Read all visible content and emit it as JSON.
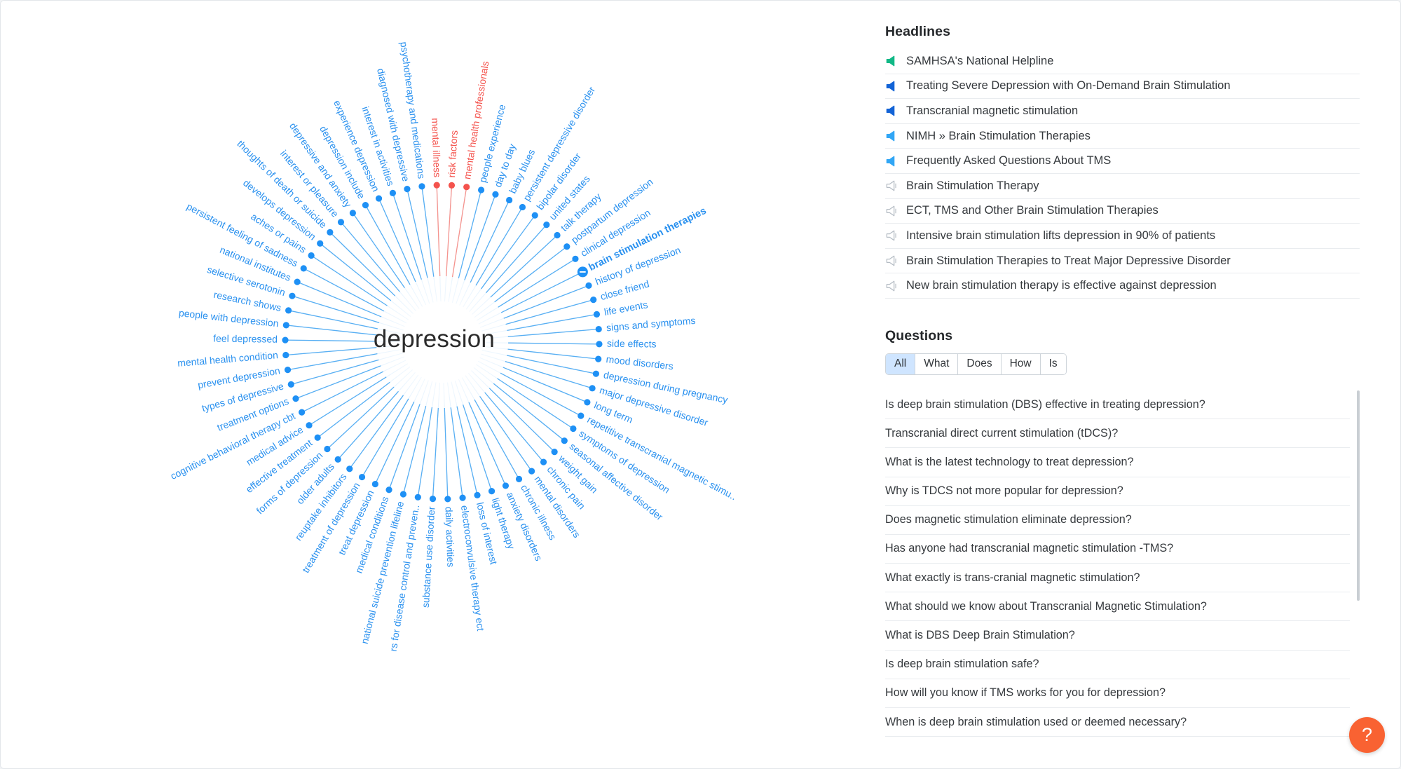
{
  "center_term": "depression",
  "graph": {
    "selected_node": "brain stimulation therapies",
    "node_colors": {
      "blue": "#1e90f5",
      "red": "#f4534d",
      "light_blue": "#6cb8f7"
    },
    "nodes": [
      {
        "label": "mental illness",
        "color": "red"
      },
      {
        "label": "risk factors",
        "color": "red"
      },
      {
        "label": "mental health professionals",
        "color": "red"
      },
      {
        "label": "people experience",
        "color": "blue"
      },
      {
        "label": "day to day",
        "color": "blue"
      },
      {
        "label": "baby blues",
        "color": "blue"
      },
      {
        "label": "persistent depressive disorder",
        "color": "blue"
      },
      {
        "label": "bipolar disorder",
        "color": "blue"
      },
      {
        "label": "united states",
        "color": "blue"
      },
      {
        "label": "talk therapy",
        "color": "blue"
      },
      {
        "label": "postpartum depression",
        "color": "blue"
      },
      {
        "label": "clinical depression",
        "color": "blue"
      },
      {
        "label": "brain stimulation therapies",
        "color": "blue",
        "selected": true
      },
      {
        "label": "history of depression",
        "color": "blue"
      },
      {
        "label": "close friend",
        "color": "blue"
      },
      {
        "label": "life events",
        "color": "blue"
      },
      {
        "label": "signs and symptoms",
        "color": "blue"
      },
      {
        "label": "side effects",
        "color": "blue"
      },
      {
        "label": "mood disorders",
        "color": "blue"
      },
      {
        "label": "depression during pregnancy",
        "color": "blue"
      },
      {
        "label": "major depressive disorder",
        "color": "blue"
      },
      {
        "label": "long term",
        "color": "blue"
      },
      {
        "label": "repetitive transcranial magnetic stimu..",
        "color": "blue"
      },
      {
        "label": "symptoms of depression",
        "color": "blue"
      },
      {
        "label": "seasonal affective disorder",
        "color": "blue"
      },
      {
        "label": "weight gain",
        "color": "blue"
      },
      {
        "label": "chronic pain",
        "color": "blue"
      },
      {
        "label": "mental disorders",
        "color": "blue"
      },
      {
        "label": "chronic illness",
        "color": "blue"
      },
      {
        "label": "anxiety disorders",
        "color": "blue"
      },
      {
        "label": "light therapy",
        "color": "blue"
      },
      {
        "label": "loss of interest",
        "color": "blue"
      },
      {
        "label": "electroconvulsive therapy ect",
        "color": "blue"
      },
      {
        "label": "daily activities",
        "color": "blue"
      },
      {
        "label": "substance use disorder",
        "color": "blue"
      },
      {
        "label": "rs for disease control and preven..",
        "color": "blue"
      },
      {
        "label": "national suicide prevention lifeline",
        "color": "blue"
      },
      {
        "label": "medical conditions",
        "color": "blue"
      },
      {
        "label": "treat depression",
        "color": "blue"
      },
      {
        "label": "treatment of depression",
        "color": "blue"
      },
      {
        "label": "reuptake inhibitors",
        "color": "blue"
      },
      {
        "label": "older adults",
        "color": "blue"
      },
      {
        "label": "forms of depression",
        "color": "blue"
      },
      {
        "label": "effective treatment",
        "color": "blue"
      },
      {
        "label": "medical advice",
        "color": "blue"
      },
      {
        "label": "cognitive behavioral therapy cbt",
        "color": "blue"
      },
      {
        "label": "treatment options",
        "color": "blue"
      },
      {
        "label": "types of depressive",
        "color": "blue"
      },
      {
        "label": "prevent depression",
        "color": "blue"
      },
      {
        "label": "mental health condition",
        "color": "blue"
      },
      {
        "label": "feel depressed",
        "color": "blue"
      },
      {
        "label": "people with depression",
        "color": "blue"
      },
      {
        "label": "research shows",
        "color": "blue"
      },
      {
        "label": "selective serotonin",
        "color": "blue"
      },
      {
        "label": "national institutes",
        "color": "blue"
      },
      {
        "label": "persistent feeling of sadness",
        "color": "blue"
      },
      {
        "label": "aches or pains",
        "color": "blue"
      },
      {
        "label": "develops depression",
        "color": "blue"
      },
      {
        "label": "thoughts of death or suicide",
        "color": "blue"
      },
      {
        "label": "interest or pleasure",
        "color": "blue"
      },
      {
        "label": "depressive and anxiety",
        "color": "blue"
      },
      {
        "label": "depression include",
        "color": "blue"
      },
      {
        "label": "experience depression",
        "color": "blue"
      },
      {
        "label": "interest in activities",
        "color": "blue"
      },
      {
        "label": "diagnosed with depressive",
        "color": "blue"
      },
      {
        "label": "psychotherapy and medications",
        "color": "blue"
      }
    ]
  },
  "headlines": {
    "title": "Headlines",
    "items": [
      {
        "text": "SAMHSA's National Helpline",
        "icon": "megaphone-icon",
        "color": "#11b886",
        "filled": true
      },
      {
        "text": "Treating Severe Depression with On-Demand Brain Stimulation",
        "icon": "megaphone-icon",
        "color": "#1263d6",
        "filled": true
      },
      {
        "text": "Transcranial magnetic stimulation",
        "icon": "megaphone-icon",
        "color": "#1263d6",
        "filled": true
      },
      {
        "text": "NIMH » Brain Stimulation Therapies",
        "icon": "megaphone-icon",
        "color": "#31a6f5",
        "filled": true
      },
      {
        "text": "Frequently Asked Questions About TMS",
        "icon": "megaphone-icon",
        "color": "#31a6f5",
        "filled": true
      },
      {
        "text": "Brain Stimulation Therapy",
        "icon": "megaphone-icon",
        "color": "#b5bcc4",
        "filled": false
      },
      {
        "text": "ECT, TMS and Other Brain Stimulation Therapies",
        "icon": "megaphone-icon",
        "color": "#b5bcc4",
        "filled": false
      },
      {
        "text": "Intensive brain stimulation lifts depression in 90% of patients",
        "icon": "megaphone-icon",
        "color": "#b5bcc4",
        "filled": false
      },
      {
        "text": "Brain Stimulation Therapies to Treat Major Depressive Disorder",
        "icon": "megaphone-icon",
        "color": "#b5bcc4",
        "filled": false
      },
      {
        "text": "New brain stimulation therapy is effective against depression",
        "icon": "megaphone-icon",
        "color": "#b5bcc4",
        "filled": false
      }
    ]
  },
  "questions": {
    "title": "Questions",
    "filters": [
      {
        "label": "All",
        "active": true
      },
      {
        "label": "What",
        "active": false
      },
      {
        "label": "Does",
        "active": false
      },
      {
        "label": "How",
        "active": false
      },
      {
        "label": "Is",
        "active": false
      }
    ],
    "items": [
      "Is deep brain stimulation (DBS) effective in treating depression?",
      "Transcranial direct current stimulation (tDCS)?",
      "What is the latest technology to treat depression?",
      "Why is TDCS not more popular for depression?",
      "Does magnetic stimulation eliminate depression?",
      "Has anyone had transcranial magnetic stimulation -TMS?",
      "What exactly is trans-cranial magnetic stimulation?",
      "What should we know about Transcranial Magnetic Stimulation?",
      "What is DBS Deep Brain Stimulation?",
      "Is deep brain stimulation safe?",
      "How will you know if TMS works for you for depression?",
      "When is deep brain stimulation used or deemed necessary?"
    ]
  },
  "help_button": {
    "glyph": "?",
    "color": "#f96232"
  }
}
